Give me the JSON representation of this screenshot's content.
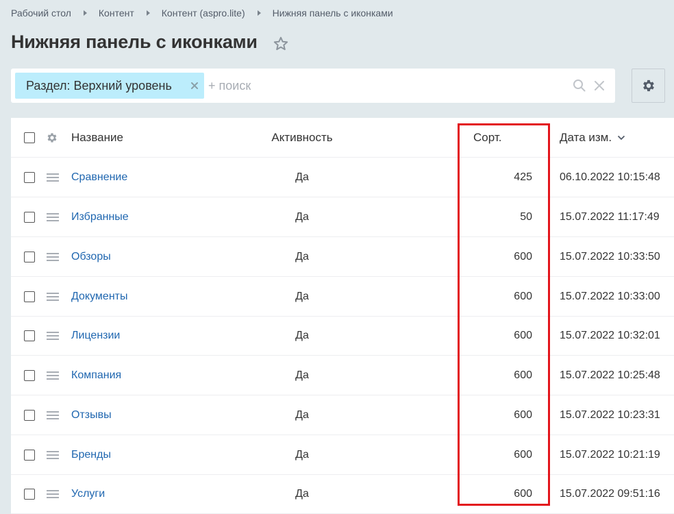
{
  "breadcrumb": [
    "Рабочий стол",
    "Контент",
    "Контент (aspro.lite)",
    "Нижняя панель с иконками"
  ],
  "page": {
    "title": "Нижняя панель с иконками"
  },
  "filter": {
    "tag_label": "Раздел: Верхний уровень",
    "search_value": "",
    "search_placeholder": "+ поиск"
  },
  "table": {
    "columns": {
      "name": "Название",
      "active": "Активность",
      "sort": "Сорт.",
      "date": "Дата изм."
    },
    "rows": [
      {
        "name": "Сравнение",
        "active": "Да",
        "sort": "425",
        "date": "06.10.2022 10:15:48"
      },
      {
        "name": "Избранные",
        "active": "Да",
        "sort": "50",
        "date": "15.07.2022 11:17:49"
      },
      {
        "name": "Обзоры",
        "active": "Да",
        "sort": "600",
        "date": "15.07.2022 10:33:50"
      },
      {
        "name": "Документы",
        "active": "Да",
        "sort": "600",
        "date": "15.07.2022 10:33:00"
      },
      {
        "name": "Лицензии",
        "active": "Да",
        "sort": "600",
        "date": "15.07.2022 10:32:01"
      },
      {
        "name": "Компания",
        "active": "Да",
        "sort": "600",
        "date": "15.07.2022 10:25:48"
      },
      {
        "name": "Отзывы",
        "active": "Да",
        "sort": "600",
        "date": "15.07.2022 10:23:31"
      },
      {
        "name": "Бренды",
        "active": "Да",
        "sort": "600",
        "date": "15.07.2022 10:21:19"
      },
      {
        "name": "Услуги",
        "active": "Да",
        "sort": "600",
        "date": "15.07.2022 09:51:16"
      }
    ]
  },
  "colors": {
    "background": "#e1e9ec",
    "link": "#2067b0",
    "tag": "#bcedfc",
    "highlight": "#e3151c"
  },
  "icons": [
    "star-icon",
    "remove-tag-icon",
    "search-icon",
    "clear-icon",
    "gear-icon",
    "drag-handle-icon",
    "chevron-down-icon"
  ]
}
